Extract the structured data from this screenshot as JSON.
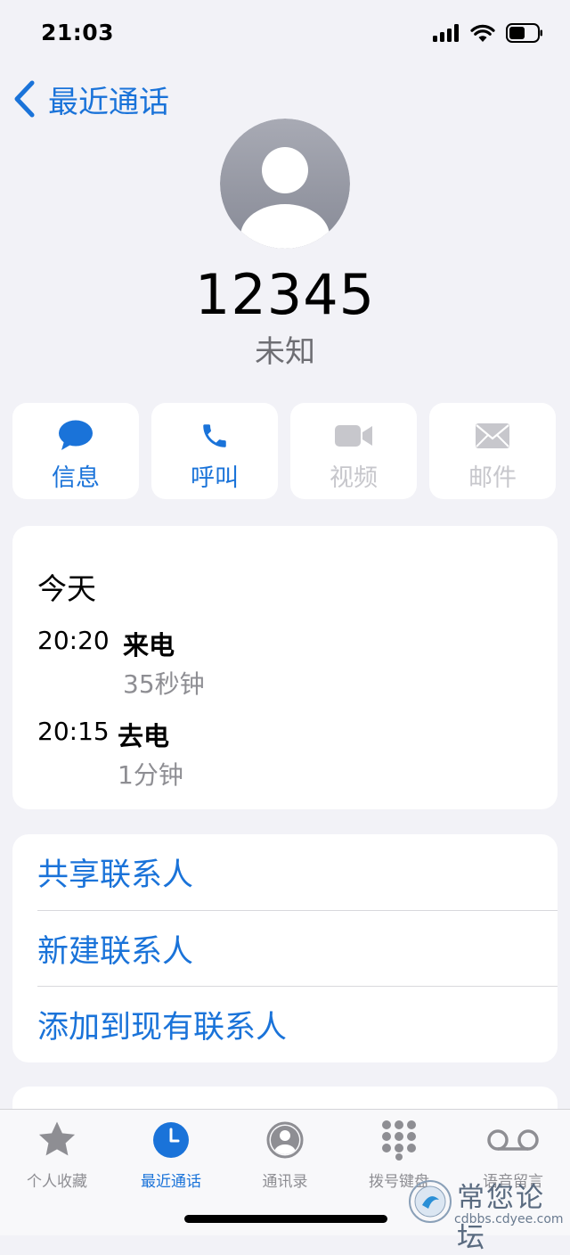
{
  "status": {
    "time": "21:03"
  },
  "nav": {
    "back_label": "最近通话"
  },
  "contact": {
    "number": "12345",
    "subtitle": "未知"
  },
  "actions": [
    {
      "label": "信息",
      "icon": "message-bubble-icon",
      "enabled": true
    },
    {
      "label": "呼叫",
      "icon": "phone-icon",
      "enabled": true
    },
    {
      "label": "视频",
      "icon": "video-camera-icon",
      "enabled": false
    },
    {
      "label": "邮件",
      "icon": "envelope-icon",
      "enabled": false
    }
  ],
  "history": {
    "day": "今天",
    "calls": [
      {
        "time": "20:20",
        "type": "来电",
        "duration": "35秒钟"
      },
      {
        "time": "20:15",
        "type": "去电",
        "duration": "1分钟"
      }
    ]
  },
  "options": [
    {
      "label": "共享联系人"
    },
    {
      "label": "新建联系人"
    },
    {
      "label": "添加到现有联系人"
    }
  ],
  "tabs": [
    {
      "label": "个人收藏",
      "icon": "star-icon",
      "active": false
    },
    {
      "label": "最近通话",
      "icon": "clock-icon",
      "active": true
    },
    {
      "label": "通讯录",
      "icon": "contacts-icon",
      "active": false
    },
    {
      "label": "拨号键盘",
      "icon": "keypad-icon",
      "active": false
    },
    {
      "label": "语音留言",
      "icon": "voicemail-icon",
      "active": false
    }
  ],
  "watermark": {
    "text": "常您论坛",
    "url": "cdbbs.cdyee.com"
  },
  "colors": {
    "accent": "#1a73d9",
    "disabled": "#c7c7cc",
    "background": "#f2f2f7"
  }
}
